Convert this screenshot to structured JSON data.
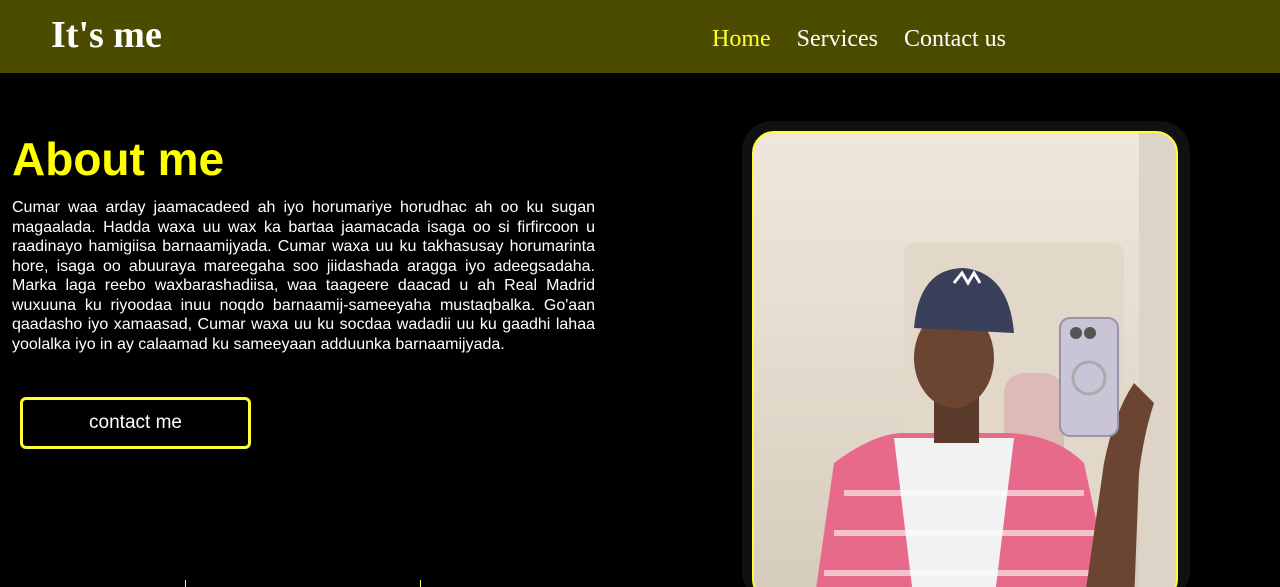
{
  "navbar": {
    "brand": "It's me",
    "links": [
      {
        "label": "Home",
        "active": true
      },
      {
        "label": "Services",
        "active": false
      },
      {
        "label": "Contact us",
        "active": false
      }
    ]
  },
  "about": {
    "title": "About me",
    "paragraph": "Cumar waa arday jaamacadeed ah iyo horumariye horudhac ah oo ku sugan magaalada. Hadda waxa uu wax ka bartaa jaamacada isaga oo si firfircoon u raadinayo hamigiisa barnaamijyada. Cumar waxa uu ku takhasusay horumarinta hore, isaga oo abuuraya mareegaha soo jiidashada aragga iyo adeegsadaha. Marka laga reebo waxbarashadiisa, waa taageere daacad u ah Real Madrid wuxuuna ku riyoodaa inuu noqdo barnaamij-sameeyaha mustaqbalka. Go'aan qaadasho iyo xamaasad, Cumar waxa uu ku socdaa wadadii uu ku gaadhi lahaa yoolalka iyo in ay calaamad ku sameeyaan adduunka barnaamijyada.",
    "button_label": "contact me"
  },
  "colors": {
    "navbar_bg": "#4c4c00",
    "accent": "#ffff33",
    "page_bg": "#000000",
    "text": "#ffffff"
  }
}
